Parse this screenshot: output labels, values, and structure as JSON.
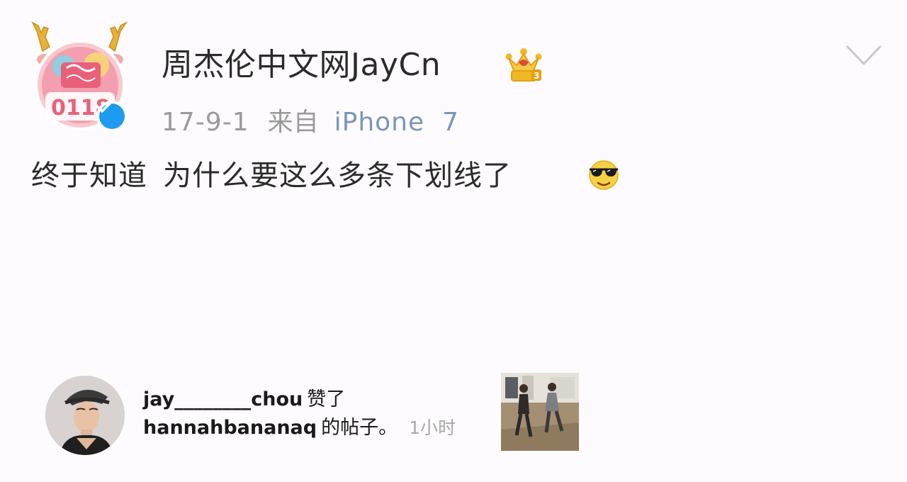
{
  "post": {
    "author": "周杰伦中文网JayCn",
    "date": "17-9-1",
    "source_prefix": "来自",
    "device": "iPhone  7",
    "text_part1": "终于知道",
    "text_part2": "为什么要这么多条下划线了",
    "emoji": "sunglasses-emoji"
  },
  "avatar": {
    "badge_text": "0118",
    "verified": true
  },
  "notification": {
    "user": "jay________chou",
    "action": "赞了",
    "target_user": "hannahbananaq",
    "target_suffix": "的帖子。",
    "time": "1小时"
  },
  "colors": {
    "background": "#fdfbfd",
    "text": "#2b2b2b",
    "meta_text": "#9a9a9a",
    "device_link": "#7a95b8",
    "verified_blue": "#1d9bf0",
    "crown_gold": "#f2b824"
  }
}
